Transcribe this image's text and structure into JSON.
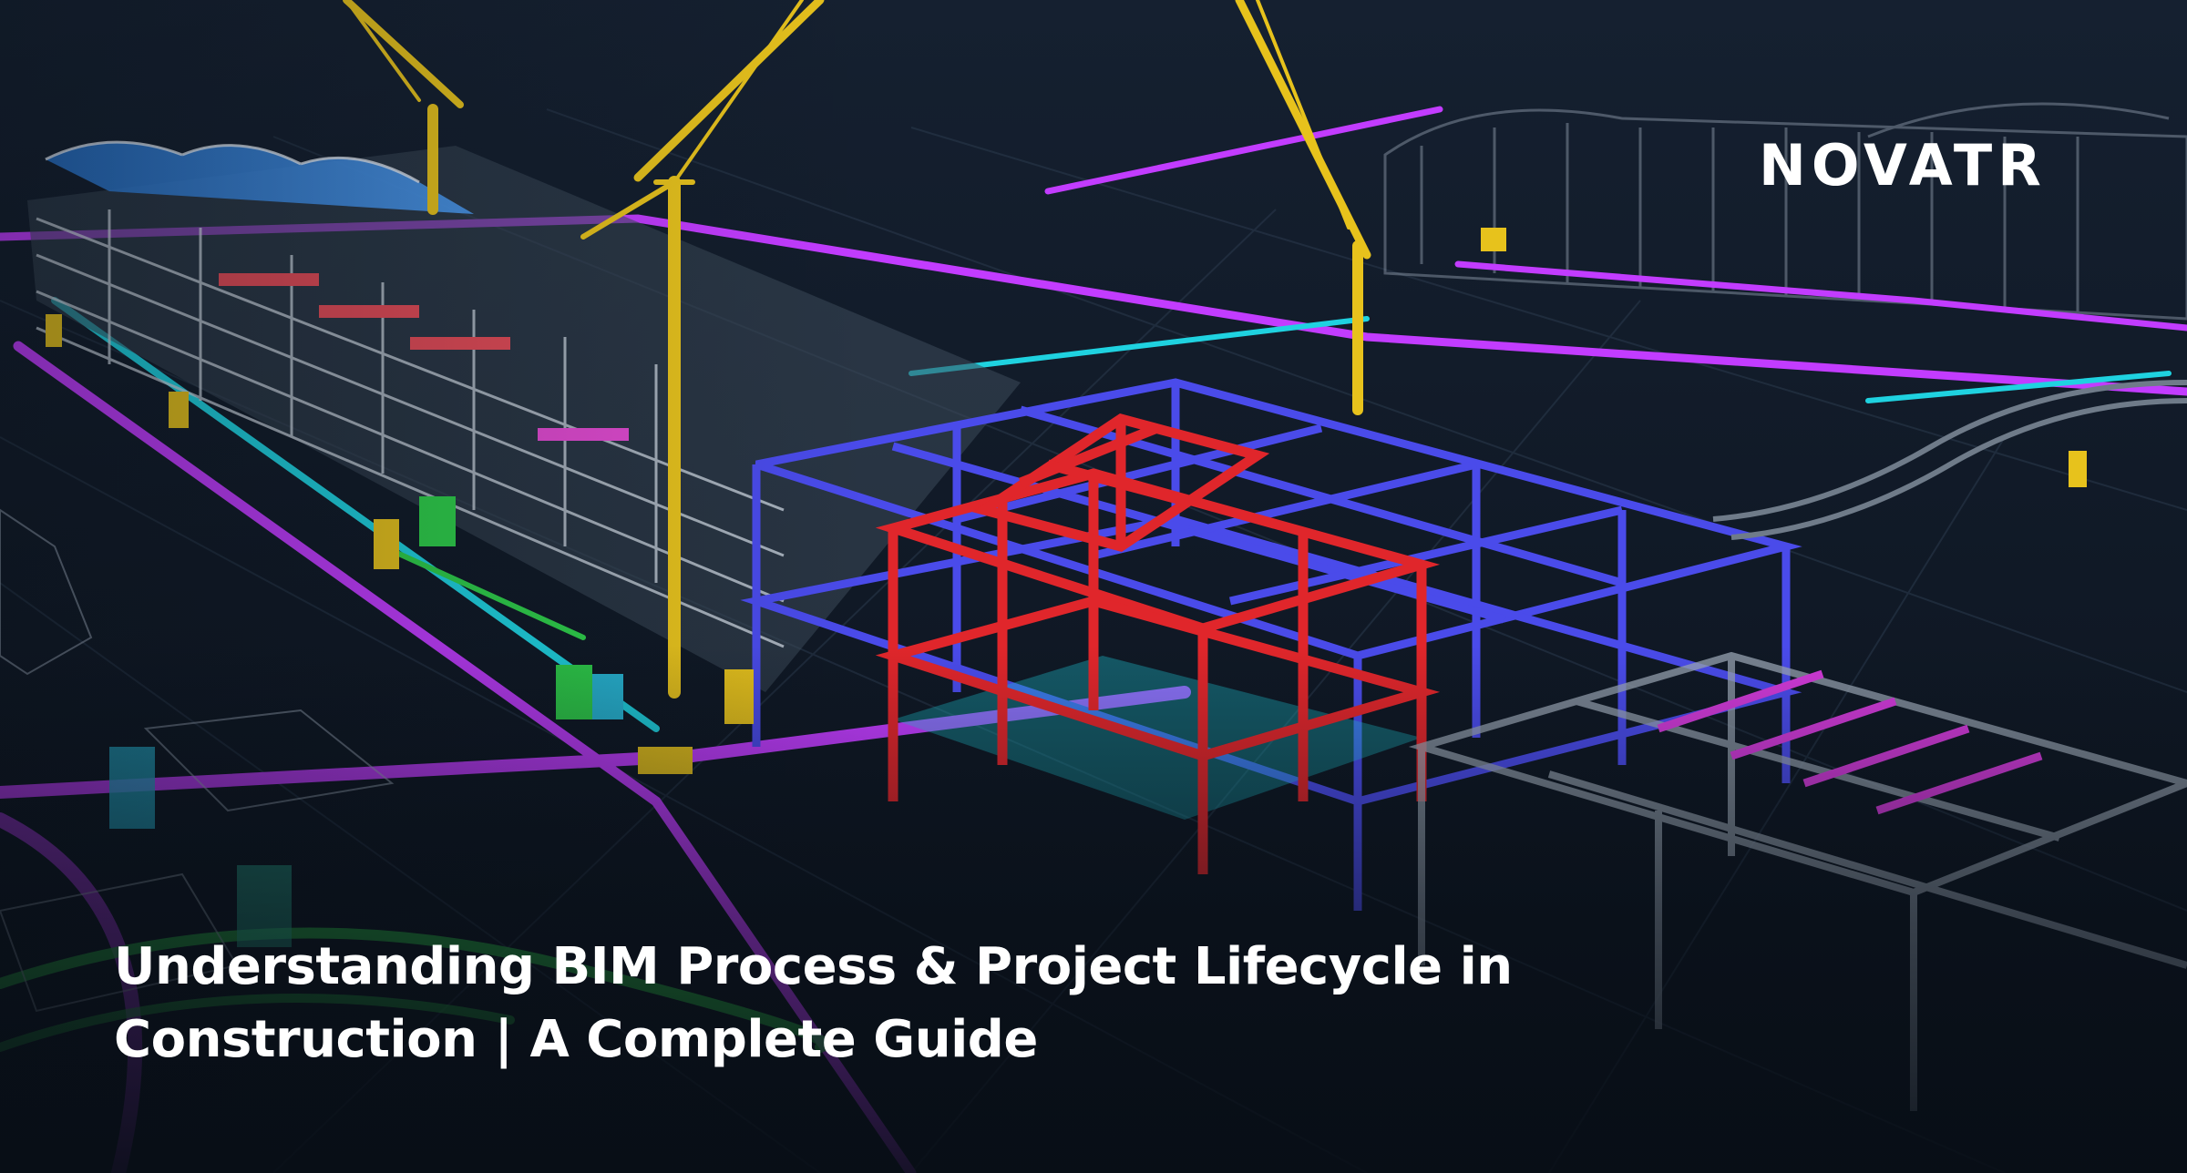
{
  "brand": {
    "logo_text": "NOVATR"
  },
  "headline": {
    "text": "Understanding BIM Process & Project Lifecycle in Construction | A Complete Guide"
  },
  "colors": {
    "background": "#0d1622",
    "structure_red": "#e0262b",
    "structure_blue": "#4a4bea",
    "crane_yellow": "#e7c21c",
    "pipe_magenta": "#c23cff",
    "pipe_cyan": "#1fd2e0",
    "pipe_green": "#2fcf4a",
    "text": "#ffffff"
  }
}
